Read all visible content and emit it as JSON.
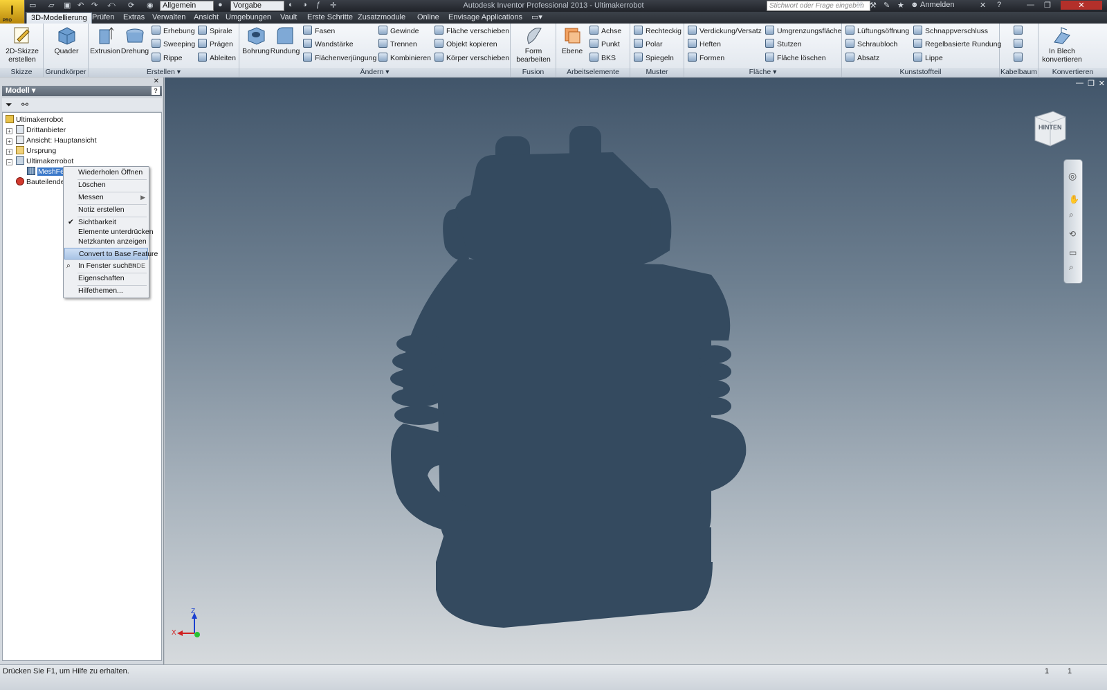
{
  "titlebar": {
    "app_button_letter": "I",
    "app_button_sub": "PRO",
    "workspace_select": "Allgemein",
    "style_select": "Vorgabe",
    "title": "Autodesk Inventor Professional 2013 - Ultimakerrobot",
    "search_placeholder": "Stichwort oder Frage eingeben",
    "signin": "Anmelden"
  },
  "tabs": [
    {
      "label": "3D-Modellierung",
      "active": true
    },
    {
      "label": "Prüfen"
    },
    {
      "label": "Extras"
    },
    {
      "label": "Verwalten"
    },
    {
      "label": "Ansicht"
    },
    {
      "label": "Umgebungen"
    },
    {
      "label": "Vault"
    },
    {
      "label": "Erste Schritte"
    },
    {
      "label": "Zusatzmodule"
    },
    {
      "label": "Online"
    },
    {
      "label": "Envisage Applications"
    }
  ],
  "ribbon": {
    "skizze": {
      "label": "Skizze",
      "btn": "2D-Skizze erstellen"
    },
    "grund": {
      "label": "Grundkörper",
      "btn": "Quader"
    },
    "erstellen": {
      "label": "Erstellen",
      "extrusion": "Extrusion",
      "drehung": "Drehung",
      "erhebung": "Erhebung",
      "sweeping": "Sweeping",
      "rippe": "Rippe",
      "spirale": "Spirale",
      "praegen": "Prägen",
      "ableiten": "Ableiten"
    },
    "aendern": {
      "label": "Ändern",
      "bohrung": "Bohrung",
      "rundung": "Rundung",
      "fasen": "Fasen",
      "wandstaerke": "Wandstärke",
      "flaechenverj": "Flächenverjüngung",
      "gewinde": "Gewinde",
      "trennen": "Trennen",
      "kombinieren": "Kombinieren",
      "flaeche_versch": "Fläche verschieben",
      "objekt_kop": "Objekt kopieren",
      "koerper_versch": "Körper verschieben"
    },
    "fusion": {
      "label": "Fusion",
      "btn": "Form bearbeiten"
    },
    "arbeits": {
      "label": "Arbeitselemente",
      "ebene": "Ebene",
      "achse": "Achse",
      "punkt": "Punkt",
      "bks": "BKS"
    },
    "muster": {
      "label": "Muster",
      "rechteckig": "Rechteckig",
      "polar": "Polar",
      "spiegeln": "Spiegeln"
    },
    "flaeche": {
      "label": "Fläche",
      "verdickung": "Verdickung/Versatz",
      "heften": "Heften",
      "formen": "Formen",
      "umgrenzung": "Umgrenzungsfläche",
      "stutzen": "Stutzen",
      "flaeche_loeschen": "Fläche löschen"
    },
    "kunststoff": {
      "label": "Kunststoffteil",
      "lueftung": "Lüftungsöffnung",
      "schraubloch": "Schraubloch",
      "absatz": "Absatz",
      "schnapp": "Schnappverschluss",
      "regel": "Regelbasierte Rundung",
      "lippe": "Lippe"
    },
    "kabel": {
      "label": "Kabelbaum"
    },
    "konv": {
      "label": "Konvertieren",
      "btn": "In Blech konvertieren"
    }
  },
  "browser": {
    "header": "Modell",
    "tree": {
      "root": "Ultimakerrobot",
      "drittanbieter": "Drittanbieter",
      "ansicht": "Ansicht: Hauptansicht",
      "ursprung": "Ursprung",
      "body": "Ultimakerrobot",
      "mesh": "MeshFeat",
      "end": "Bauteilende"
    }
  },
  "context_menu": {
    "wiederholen": "Wiederholen Öffnen",
    "loeschen": "Löschen",
    "messen": "Messen",
    "notiz": "Notiz erstellen",
    "sichtbarkeit": "Sichtbarkeit",
    "unterdruecken": "Elemente unterdrücken",
    "netzkanten": "Netzkanten anzeigen",
    "convert": "Convert to Base Feature",
    "fenster": "In Fenster suchen",
    "fenster_shortcut": "ENDE",
    "eigenschaften": "Eigenschaften",
    "hilfe": "Hilfethemen..."
  },
  "viewport": {
    "viewcube_face": "HINTEN",
    "axis_z": "Z",
    "axis_x": "X",
    "model_color": "#344a5f"
  },
  "status": {
    "text": "Drücken Sie F1, um Hilfe zu erhalten.",
    "num1": "1",
    "num2": "1"
  }
}
